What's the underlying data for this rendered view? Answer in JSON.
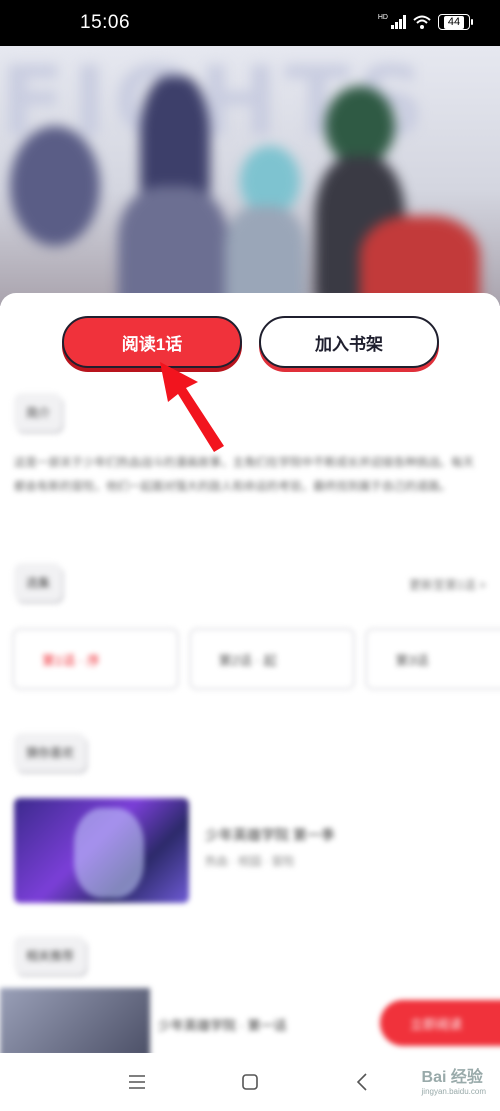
{
  "status_bar": {
    "time": "15:06",
    "network_tag": "HD",
    "battery": "44",
    "icons": [
      "signal-icon",
      "wifi-icon",
      "battery-icon"
    ]
  },
  "hero": {
    "background_text": "FIGHTS",
    "accent": "#f0323b"
  },
  "actions": {
    "read_label": "阅读1话",
    "shelf_label": "加入书架"
  },
  "annotation": {
    "arrow_color": "#f2141e"
  },
  "blurred": {
    "intro_chip": "简介",
    "description": "这是一部关于少年们热血战斗的漫画故事，主角们在学院中不断成长并迎接各种挑战。每天都会有新的冒险，他们一起面对强大的敌人和命运的考验，最终找到属于自己的道路。",
    "chapters_chip": "选集",
    "more_label": "更新至第1话 >",
    "chapters": [
      "第1话 · 序",
      "第2话 · 起",
      "第3话"
    ],
    "recommend_chip": "猜你喜欢",
    "recommend_title": "少年英雄学院 第一季",
    "recommend_sub": "热血 · 校园 · 冒险",
    "related_chip": "相关推荐",
    "bottom_title": "少年英雄学院 · 第一话",
    "bottom_button": "立即阅读"
  },
  "nav": {
    "items": [
      "menu-icon",
      "home-icon",
      "back-icon"
    ],
    "watermark_main": "Bai 经验",
    "watermark_sub": "jingyan.baidu.com"
  }
}
